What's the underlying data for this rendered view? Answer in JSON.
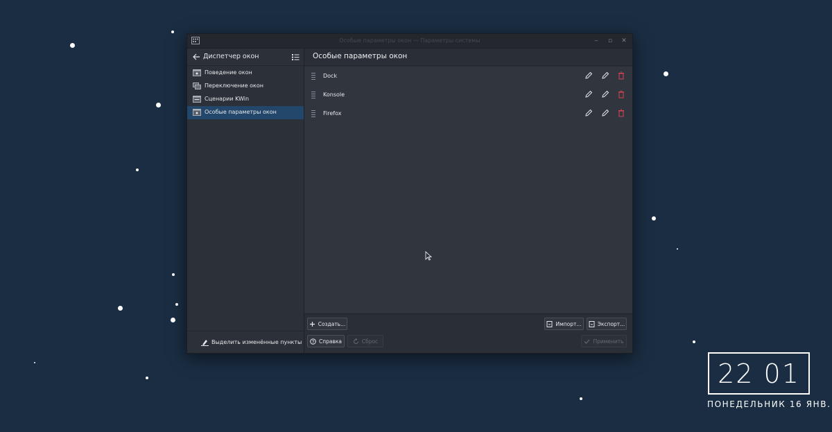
{
  "window": {
    "title": "Особые параметры окон — Параметры системы"
  },
  "sidebar": {
    "header_title": "Диспетчер окон",
    "items": [
      {
        "label": "Поведение окон",
        "active": false
      },
      {
        "label": "Переключение окон",
        "active": false
      },
      {
        "label": "Сценарии KWin",
        "active": false
      },
      {
        "label": "Особые параметры окон",
        "active": true
      }
    ],
    "footer_label": "Выделить изменённые пункты"
  },
  "main": {
    "title": "Особые параметры окон",
    "rules": [
      {
        "name": "Dock"
      },
      {
        "name": "Konsole"
      },
      {
        "name": "Firefox"
      }
    ]
  },
  "buttons": {
    "create": "Создать...",
    "import": "Импорт...",
    "export": "Экспорт...",
    "help": "Справка",
    "reset": "Сброс",
    "apply": "Применить"
  },
  "clock": {
    "time": "22 01",
    "date": "ПОНЕДЕЛЬНИК 16 ЯНВ."
  },
  "colors": {
    "desktop": "#1a2d42",
    "accent": "#22476a",
    "delete": "#da4453"
  }
}
